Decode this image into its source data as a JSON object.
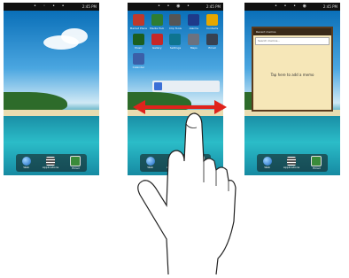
{
  "status": {
    "time": "2:45 PM"
  },
  "dock": [
    {
      "label": "Web",
      "icon": "globe-icon"
    },
    {
      "label": "Applications",
      "icon": "apps-grid-icon"
    },
    {
      "label": "Email",
      "icon": "email-icon"
    }
  ],
  "apps": [
    {
      "label": "Market Place",
      "icon": "market-icon",
      "color": "#c0392b"
    },
    {
      "label": "Media Hub",
      "icon": "media-hub-icon",
      "color": "#2e7d32"
    },
    {
      "label": "Clip Tools",
      "icon": "clip-icon",
      "color": "#555555"
    },
    {
      "label": "Alarms",
      "icon": "alarm-icon",
      "color": "#1e3a8a"
    },
    {
      "label": "Contacts",
      "icon": "contacts-icon",
      "color": "#e6a700"
    },
    {
      "label": "Music",
      "icon": "music-icon",
      "color": "#1b5e20"
    },
    {
      "label": "Gallery",
      "icon": "gallery-icon",
      "color": "#c62828"
    },
    {
      "label": "Settings",
      "icon": "settings-icon",
      "color": "#0e7490"
    },
    {
      "label": "Maps",
      "icon": "maps-icon",
      "color": "#6b7280"
    },
    {
      "label": "Email",
      "icon": "email-icon",
      "color": "#374151"
    },
    {
      "label": "Calendar",
      "icon": "calendar-icon",
      "color": "#3b5fa8"
    }
  ],
  "memo": {
    "header": "Recent memos",
    "search_placeholder": "Search memos...",
    "body": "Tap here to add a memo"
  },
  "colors": {
    "arrow": "#e0231c",
    "memo_paper": "#f6e7b8",
    "memo_border": "#5a3b1e"
  }
}
